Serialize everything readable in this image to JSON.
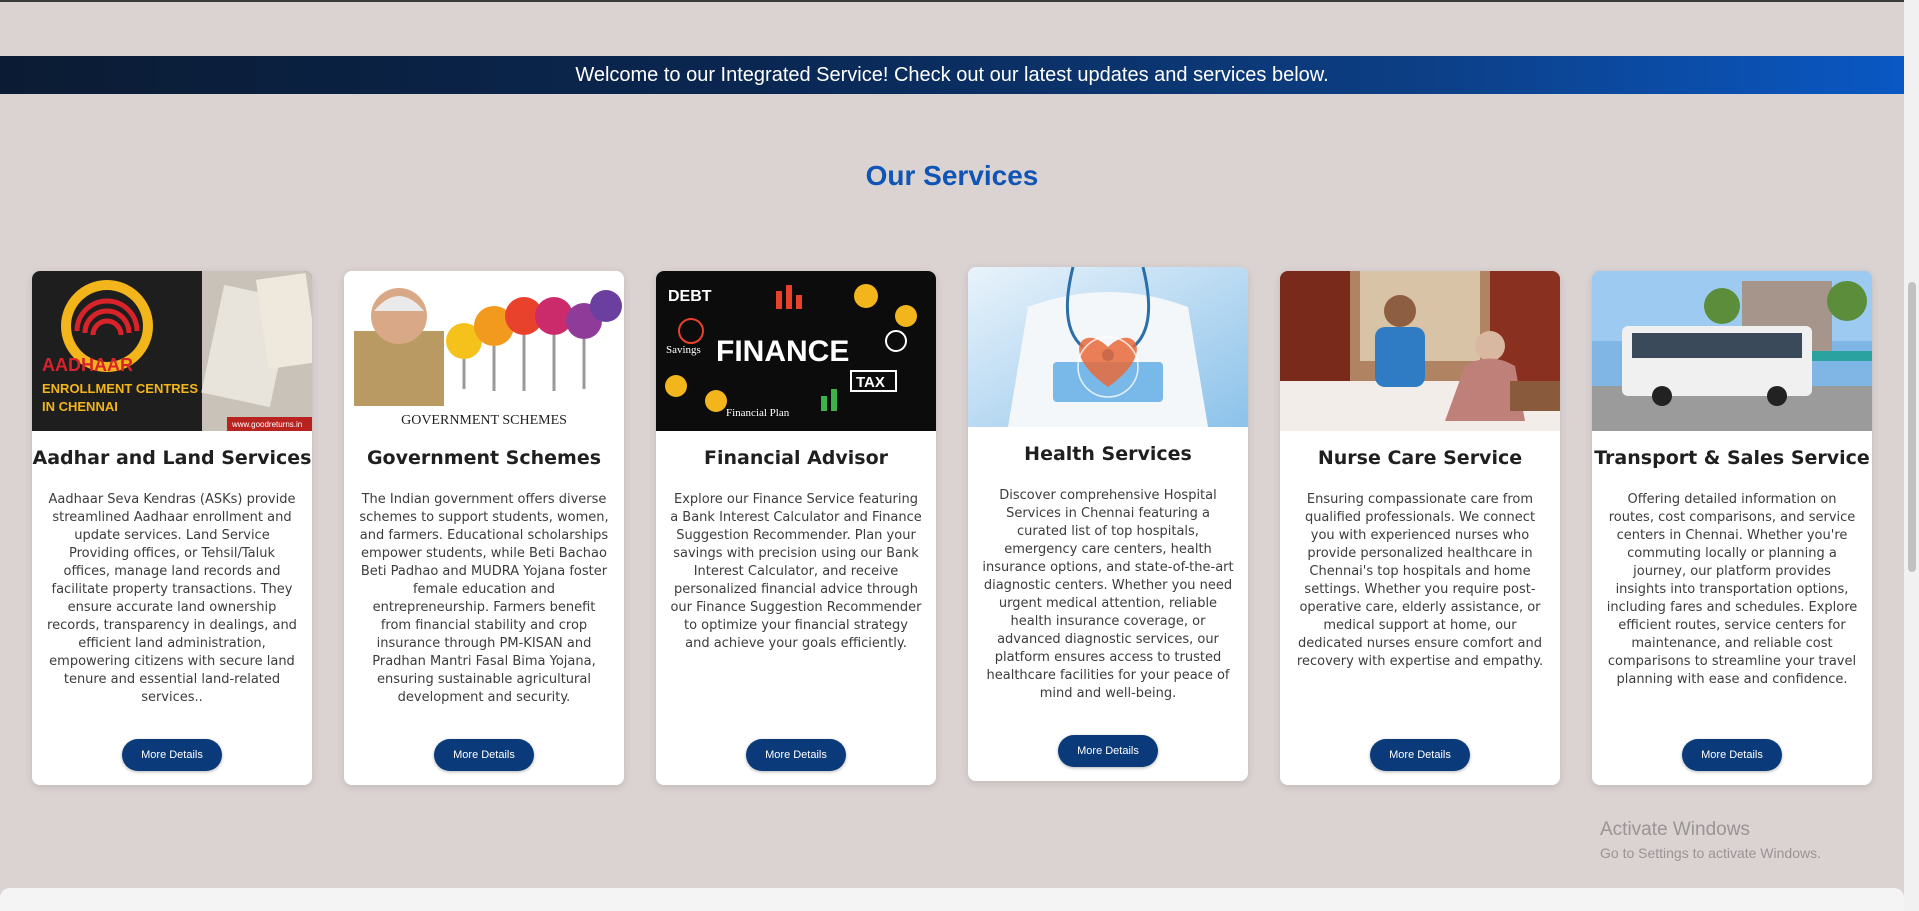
{
  "banner": {
    "text": "Welcome to our Integrated Service! Check out our latest updates and services below."
  },
  "section": {
    "title": "Our Services"
  },
  "services": [
    {
      "title": "Aadhar and Land Services",
      "description": "Aadhaar Seva Kendras (ASKs) provide streamlined Aadhaar enrollment and update services. Land Service Providing offices, or Tehsil/Taluk offices, manage land records and facilitate property transactions. They ensure accurate land ownership records, transparency in dealings, and efficient land administration, empowering citizens with secure land tenure and essential land-related services..",
      "button": "More Details",
      "image_text": {
        "line1": "AADHAAR",
        "line2": "ENROLLMENT CENTRES",
        "line3": "IN CHENNAI",
        "credit": "www.goodreturns.in"
      }
    },
    {
      "title": "Government Schemes",
      "description": "The Indian government offers diverse schemes to support students, women, and farmers. Educational scholarships empower students, while Beti Bachao Beti Padhao and MUDRA Yojana foster female education and entrepreneurship. Farmers benefit from financial stability and crop insurance through PM-KISAN and Pradhan Mantri Fasal Bima Yojana, ensuring sustainable agricultural development and security.",
      "button": "More Details",
      "image_text": {
        "caption": "GOVERNMENT SCHEMES"
      }
    },
    {
      "title": "Financial Advisor",
      "description": "Explore our Finance Service featuring a Bank Interest Calculator and Finance Suggestion Recommender. Plan your savings with precision using our Bank Interest Calculator, and receive personalized financial advice through our Finance Suggestion Recommender to optimize your financial strategy and achieve your goals efficiently.",
      "button": "More Details",
      "image_text": {
        "main": "FINANCE",
        "debt": "DEBT",
        "tax": "TAX",
        "savings": "Savings",
        "plan": "Financial Plan"
      }
    },
    {
      "title": "Health Services",
      "description": "Discover comprehensive Hospital Services in Chennai featuring a curated list of top hospitals, emergency care centers, health insurance options, and state-of-the-art diagnostic centers. Whether you need urgent medical attention, reliable health insurance coverage, or advanced diagnostic services, our platform ensures access to trusted healthcare facilities for your peace of mind and well-being.",
      "button": "More Details"
    },
    {
      "title": "Nurse Care Service",
      "description": "Ensuring compassionate care from qualified professionals. We connect you with experienced nurses who provide personalized healthcare in Chennai's top hospitals and home settings. Whether you require post-operative care, elderly assistance, or medical support at home, our dedicated nurses ensure comfort and recovery with expertise and empathy.",
      "button": "More Details"
    },
    {
      "title": "Transport & Sales Service",
      "description": "Offering detailed information on routes, cost comparisons, and service centers in Chennai. Whether you're commuting locally or planning a journey, our platform provides insights into transportation options, including fares and schedules. Explore efficient routes, service centers for maintenance, and reliable cost comparisons to streamline your travel planning with ease and confidence.",
      "button": "More Details"
    }
  ],
  "watermark": {
    "line1": "Activate Windows",
    "line2": "Go to Settings to activate Windows."
  },
  "colors": {
    "banner_dark": "#0b1b33",
    "banner_light": "#0a58c4",
    "heading": "#0f55b5",
    "button": "#0a3a7a",
    "page_bg": "#dbd2d2"
  }
}
